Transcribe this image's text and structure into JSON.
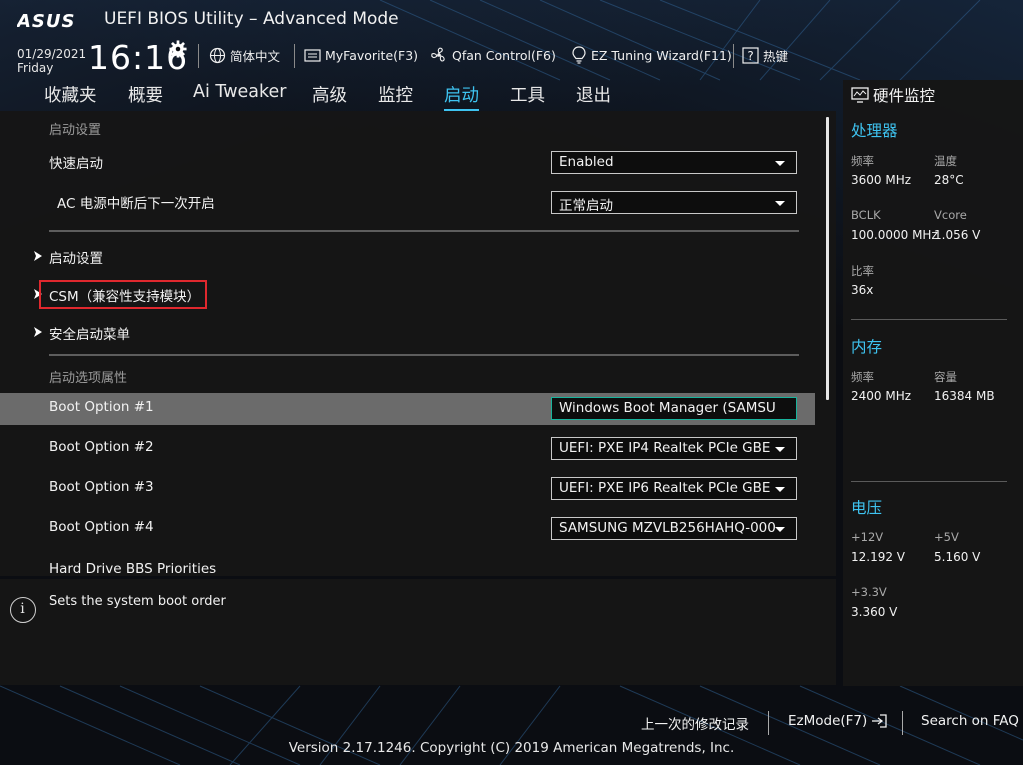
{
  "header": {
    "brand": "ASUS",
    "title": "UEFI BIOS Utility – Advanced Mode",
    "date": "01/29/2021",
    "weekday": "Friday",
    "time": "16:16",
    "buttons": [
      {
        "label": "简体中文",
        "icon": "globe-icon"
      },
      {
        "label": "MyFavorite(F3)",
        "icon": "favorite-icon"
      },
      {
        "label": "Qfan Control(F6)",
        "icon": "fan-icon"
      },
      {
        "label": "EZ Tuning Wizard(F11)",
        "icon": "lightbulb-icon"
      },
      {
        "label": "热键",
        "icon": "question-icon"
      }
    ]
  },
  "tabs": [
    {
      "label": "收藏夹",
      "active": false
    },
    {
      "label": "概要",
      "active": false
    },
    {
      "label": "Ai Tweaker",
      "active": false
    },
    {
      "label": "高级",
      "active": false
    },
    {
      "label": "监控",
      "active": false
    },
    {
      "label": "启动",
      "active": true
    },
    {
      "label": "工具",
      "active": false
    },
    {
      "label": "退出",
      "active": false
    }
  ],
  "main": {
    "section1": "启动设置",
    "fast_boot": {
      "label": "快速启动",
      "value": "Enabled"
    },
    "ac_power": {
      "label": "AC 电源中断后下一次开启",
      "value": "正常启动"
    },
    "submenus": [
      "启动设置",
      "CSM（兼容性支持模块）",
      "安全启动菜单"
    ],
    "section2": "启动选项属性",
    "boot_options": [
      {
        "label": "Boot Option #1",
        "value": "Windows Boot Manager (SAMSU"
      },
      {
        "label": "Boot Option #2",
        "value": "UEFI: PXE IP4 Realtek PCIe GBE"
      },
      {
        "label": "Boot Option #3",
        "value": "UEFI: PXE IP6 Realtek PCIe GBE"
      },
      {
        "label": "Boot Option #4",
        "value": "SAMSUNG MZVLB256HAHQ-000"
      }
    ],
    "partial_item": "Hard Drive BBS Priorities"
  },
  "help": {
    "text": "Sets the system boot order",
    "icon": "info-icon"
  },
  "monitor": {
    "title": "硬件监控",
    "cpu": {
      "heading": "处理器",
      "freq_label": "频率",
      "freq": "3600 MHz",
      "temp_label": "温度",
      "temp": "28°C",
      "bclk_label": "BCLK",
      "bclk": "100.0000 MHz",
      "vcore_label": "Vcore",
      "vcore": "1.056 V",
      "ratio_label": "比率",
      "ratio": "36x"
    },
    "memory": {
      "heading": "内存",
      "freq_label": "频率",
      "freq": "2400 MHz",
      "cap_label": "容量",
      "cap": "16384 MB"
    },
    "voltage": {
      "heading": "电压",
      "v12_label": "+12V",
      "v12": "12.192 V",
      "v5_label": "+5V",
      "v5": "5.160 V",
      "v33_label": "+3.3V",
      "v33": "3.360 V"
    }
  },
  "footer": {
    "last_changes": "上一次的修改记录",
    "ezmode": "EzMode(F7)",
    "faq": "Search on FAQ",
    "version": "Version 2.17.1246. Copyright (C) 2019 American Megatrends, Inc."
  },
  "colors": {
    "accent": "#3ec3f0",
    "highlight_row": "#6b6b6b",
    "annotation_box": "#e0282e"
  }
}
